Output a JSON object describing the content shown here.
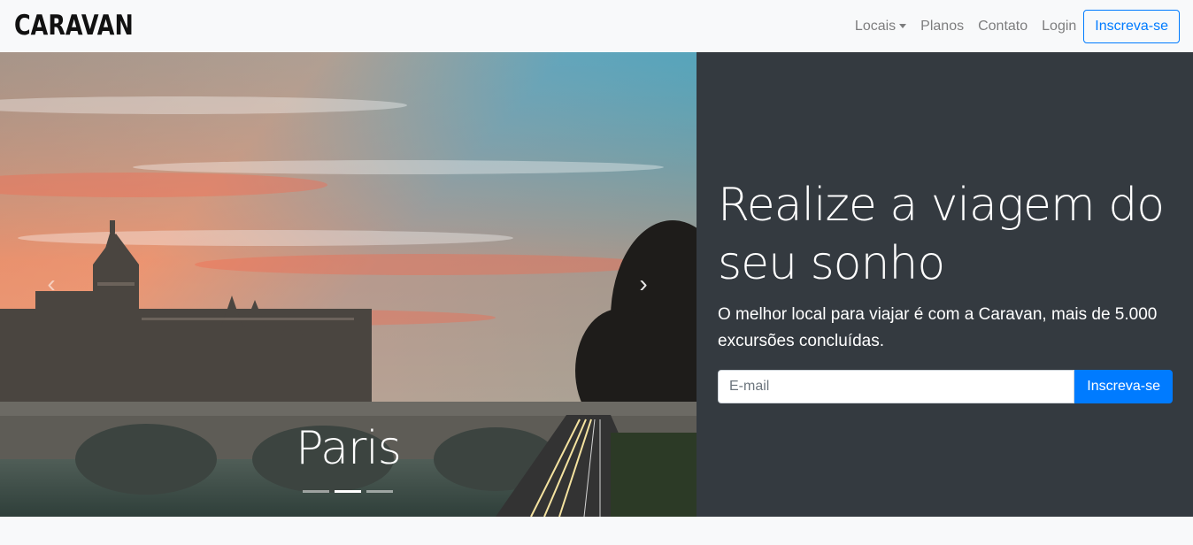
{
  "navbar": {
    "brand": "CARAVAN",
    "links": [
      {
        "label": "Locais",
        "dropdown": true
      },
      {
        "label": "Planos"
      },
      {
        "label": "Contato"
      },
      {
        "label": "Login"
      }
    ],
    "signup_label": "Inscreva-se"
  },
  "carousel": {
    "caption": "Paris",
    "prev_icon": "chevron-left-icon",
    "next_icon": "chevron-right-icon",
    "indicator_count": 3,
    "active_indicator": 2
  },
  "hero": {
    "headline": "Realize a viagem do seu sonho",
    "lead": "O melhor local para viajar é com a Caravan, mais de 5.000 excursões concluídas.",
    "email_placeholder": "E-mail",
    "email_value": "",
    "submit_label": "Inscreva-se"
  },
  "colors": {
    "primary": "#007bff",
    "panel_bg": "#343a40",
    "navbar_bg": "#f8f9fa"
  }
}
